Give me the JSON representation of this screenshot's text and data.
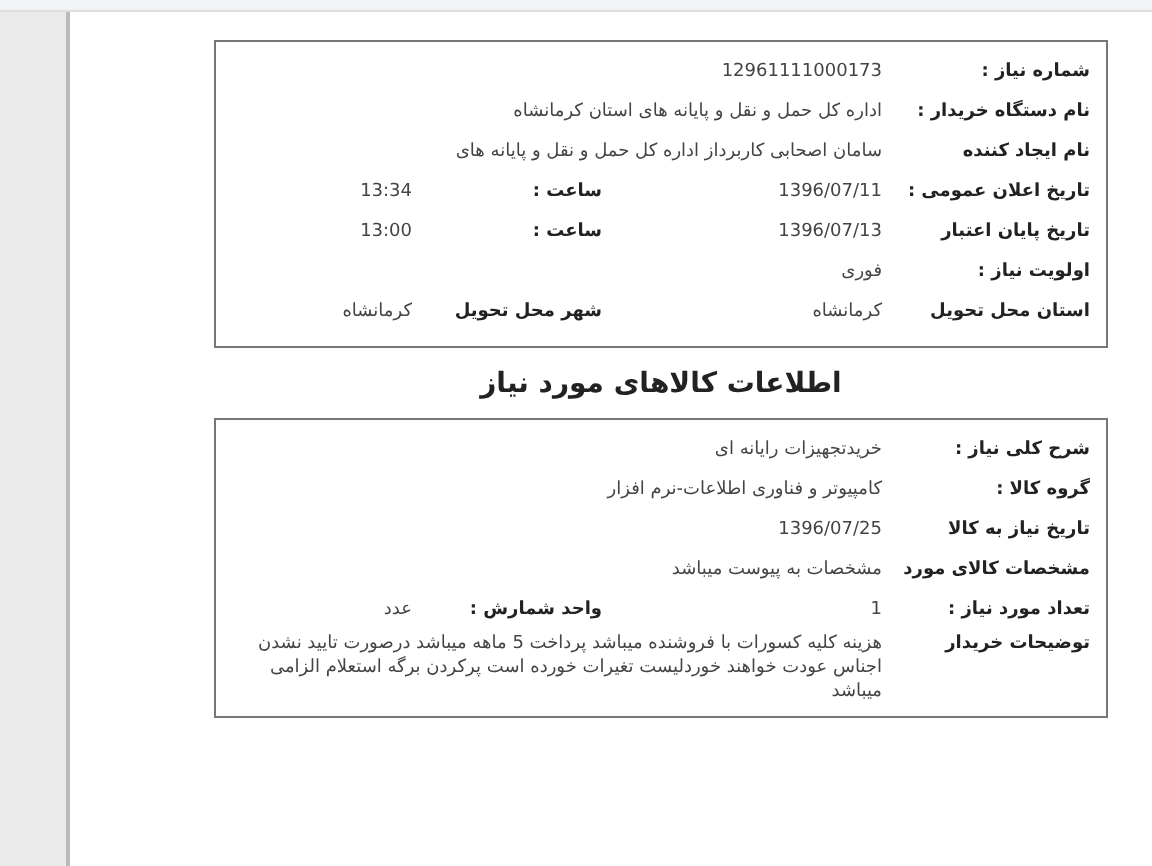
{
  "request_info": {
    "rows": [
      {
        "label": "شماره نیاز :",
        "value": "12961111000173"
      },
      {
        "label": "نام دستگاه خریدار :",
        "value": "اداره کل حمل و نقل و پایانه های استان کرمانشاه"
      },
      {
        "label": "نام ایجاد کننده",
        "value": "سامان  اصحابی کاربرداز اداره کل حمل و نقل و پایانه های"
      },
      {
        "label": "تاریخ اعلان عمومی :",
        "value": "1396/07/11",
        "extra_label": "ساعت :",
        "extra_value": "13:34"
      },
      {
        "label": "تاریخ پایان اعتبار",
        "value": "1396/07/13",
        "extra_label": "ساعت :",
        "extra_value": "13:00"
      },
      {
        "label": "اولویت نیاز :",
        "value": "فوری"
      },
      {
        "label": "استان محل تحویل",
        "value": "کرمانشاه",
        "extra_label": "شهر محل تحویل",
        "extra_value": "کرمانشاه"
      }
    ]
  },
  "goods_heading": "اطلاعات کالاهای مورد نیاز",
  "goods_info": {
    "rows": [
      {
        "label": "شرح کلی نیاز :",
        "value": "خریدتجهیزات رایانه ای"
      },
      {
        "label": "گروه کالا :",
        "value": "کامپیوتر و فناوری اطلاعات-نرم افزار"
      },
      {
        "label": "تاریخ نیاز به کالا",
        "value": "1396/07/25"
      },
      {
        "label": "مشخصات کالای مورد",
        "value": "مشخصات به پیوست میباشد"
      },
      {
        "label": "تعداد مورد نیاز :",
        "value": "1",
        "extra_label": "واحد شمارش :",
        "extra_value": "عدد"
      },
      {
        "label": "توضیحات خریدار",
        "value": "هزینه کلیه کسورات با فروشنده میباشد پرداخت 5 ماهه میباشد درصورت تایید نشدن اجناس عودت خواهند خوردلیست تغیرات خورده است پرکردن برگه استعلام الزامی میباشد"
      }
    ]
  }
}
